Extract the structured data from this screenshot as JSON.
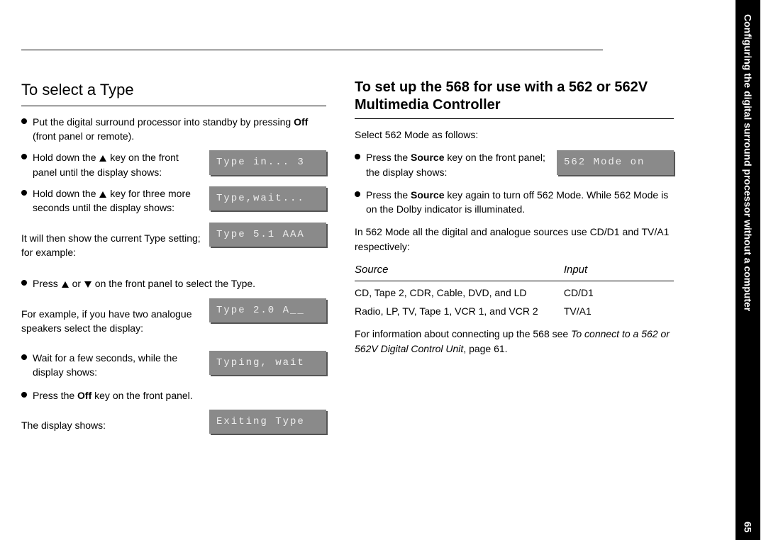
{
  "sidebar": {
    "chapter": "Configuring the digital surround processor without a computer",
    "page": "65"
  },
  "left": {
    "heading": "To select a Type",
    "b1a": "Put the digital surround processor into standby by pressing ",
    "b1b": "Off",
    "b1c": " (front panel or remote).",
    "b2a": "Hold down the ",
    "b2b": " key on the front panel until the display shows:",
    "lcd1": "Type in... 3",
    "b3a": "Hold down the ",
    "b3b": " key for three more seconds until the display shows:",
    "lcd2": "Type,wait...",
    "p1": "It will then show the current Type setting; for example:",
    "lcd3": "Type 5.1 AAA",
    "b4a": "Press ",
    "b4b": " or ",
    "b4c": " on the front panel to select the Type.",
    "p2": "For example, if you have two analogue speakers select the display:",
    "lcd4": "Type 2.0 A__",
    "b5": "Wait for a few seconds, while the display shows:",
    "lcd5": "Typing, wait",
    "b6a": "Press the ",
    "b6b": "Off",
    "b6c": " key on the front panel.",
    "p3": "The display shows:",
    "lcd6": "Exiting Type"
  },
  "right": {
    "heading": "To set up the 568 for use with a 562 or 562V Multimedia Controller",
    "p1": "Select 562 Mode as follows:",
    "b1a": "Press the ",
    "b1b": "Source",
    "b1c": " key on the front panel; the display shows:",
    "lcd1": "562 Mode on",
    "b2a": "Press the ",
    "b2b": "Source",
    "b2c": " key again to turn off 562 Mode. While 562 Mode is on the Dolby indicator is illuminated.",
    "p2": "In 562 Mode all the digital and analogue sources use CD/D1 and TV/A1 respectively:",
    "table": {
      "h1": "Source",
      "h2": "Input",
      "r1c1": "CD, Tape 2, CDR, Cable, DVD, and LD",
      "r1c2": "CD/D1",
      "r2c1": "Radio, LP, TV, Tape 1, VCR 1, and VCR 2",
      "r2c2": "TV/A1"
    },
    "p3a": "For information about connecting up the 568 see ",
    "p3b": "To connect to a 562 or 562V Digital Control Unit",
    "p3c": ", page 61."
  }
}
